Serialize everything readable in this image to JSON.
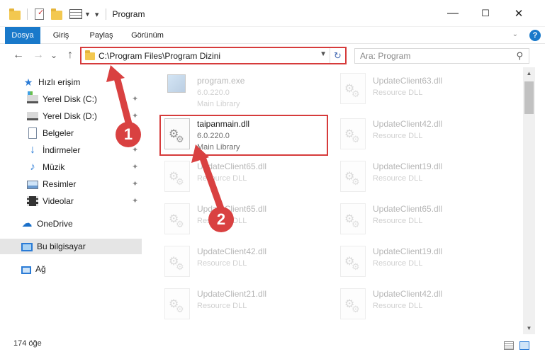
{
  "window": {
    "title": "Program",
    "minimize": "—",
    "maximize": "☐",
    "close": "✕"
  },
  "ribbon": {
    "tabs": [
      {
        "label": "Dosya",
        "active": true
      },
      {
        "label": "Giriş"
      },
      {
        "label": "Paylaş"
      },
      {
        "label": "Görünüm"
      }
    ],
    "help": "?"
  },
  "nav": {
    "back": "←",
    "forward": "→",
    "recent": "⌄",
    "up": "↑",
    "address": "C:\\Program Files\\Program Dizini",
    "refresh": "↻",
    "search_placeholder": "Ara: Program",
    "accent": "#d63b3b"
  },
  "sidebar": {
    "items": [
      {
        "label": "Hızlı erişim",
        "icon": "star-icon"
      },
      {
        "label": "Yerel Disk (C:)",
        "icon": "drive-c-icon",
        "pinned": true
      },
      {
        "label": "Yerel Disk (D:)",
        "icon": "drive-icon",
        "pinned": true
      },
      {
        "label": "Belgeler",
        "icon": "documents-icon",
        "pinned": true
      },
      {
        "label": "İndirmeler",
        "icon": "download-icon",
        "pinned": true
      },
      {
        "label": "Müzik",
        "icon": "music-icon",
        "pinned": true
      },
      {
        "label": "Resimler",
        "icon": "pictures-icon",
        "pinned": true
      },
      {
        "label": "Videolar",
        "icon": "videos-icon",
        "pinned": true
      },
      {
        "label": "OneDrive",
        "icon": "onedrive-icon"
      },
      {
        "label": "Bu bilgisayar",
        "icon": "this-pc-icon",
        "selected": true
      },
      {
        "label": "Ağ",
        "icon": "network-icon"
      }
    ]
  },
  "files": [
    {
      "name": "program.exe",
      "line1": "6.0.220.0",
      "line2": "Main Library",
      "kind": "exe"
    },
    {
      "name": "UpdateClient63.dll",
      "line1": "Resource DLL",
      "line2": "",
      "kind": "dll"
    },
    {
      "name": "taipanmain.dll",
      "line1": "6.0.220.0",
      "line2": "Main Library",
      "kind": "dll",
      "highlighted": true
    },
    {
      "name": "UpdateClient42.dll",
      "line1": "Resource DLL",
      "line2": "",
      "kind": "dll"
    },
    {
      "name": "UpdateClient65.dll",
      "line1": "Resource DLL",
      "line2": "",
      "kind": "dll"
    },
    {
      "name": "UpdateClient19.dll",
      "line1": "Resource DLL",
      "line2": "",
      "kind": "dll"
    },
    {
      "name": "UpdateClient65.dll",
      "line1": "Resource DLL",
      "line2": "",
      "kind": "dll"
    },
    {
      "name": "UpdateClient65.dll",
      "line1": "Resource DLL",
      "line2": "",
      "kind": "dll"
    },
    {
      "name": "UpdateClient42.dll",
      "line1": "Resource DLL",
      "line2": "",
      "kind": "dll"
    },
    {
      "name": "UpdateClient19.dll",
      "line1": "Resource DLL",
      "line2": "",
      "kind": "dll"
    },
    {
      "name": "UpdateClient21.dll",
      "line1": "Resource DLL",
      "line2": "",
      "kind": "dll"
    },
    {
      "name": "UpdateClient42.dll",
      "line1": "Resource DLL",
      "line2": "",
      "kind": "dll"
    }
  ],
  "status": {
    "item_count": "174 öğe"
  },
  "annotations": [
    {
      "number": "1",
      "color": "#d94141"
    },
    {
      "number": "2",
      "color": "#d94141"
    }
  ]
}
